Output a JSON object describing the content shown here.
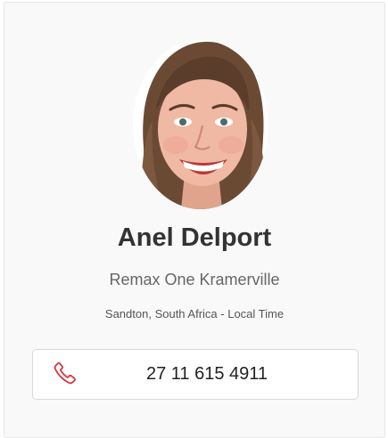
{
  "agent": {
    "name": "Anel Delport",
    "agency": "Remax One Kramerville",
    "location": "Sandton, South Africa - Local Time",
    "phone": "27 11 615 4911",
    "photo_icon": "agent-photo"
  },
  "icons": {
    "phone": "phone-icon"
  },
  "colors": {
    "accent": "#d7333b",
    "name_text": "#333333",
    "card_bg": "#f9f9f9"
  }
}
